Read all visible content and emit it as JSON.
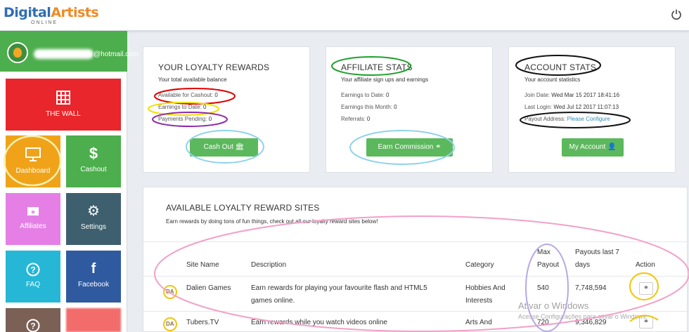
{
  "brand": {
    "logo_main": "Digital",
    "logo_accent": "Artists",
    "logo_sub": "ONLINE"
  },
  "user": {
    "email_suffix": "@hotmail.com"
  },
  "sidebar": {
    "items": [
      {
        "label": "THE WALL",
        "icon": "grid-icon",
        "color": "#e8262b"
      },
      {
        "label": "Dashboard",
        "icon": "monitor-icon",
        "color": "#f0a319"
      },
      {
        "label": "Cashout",
        "icon": "dollar-icon",
        "color": "#4cae4c"
      },
      {
        "label": "Affiliates",
        "icon": "ticket-icon",
        "color": "#e57fe6"
      },
      {
        "label": "Settings",
        "icon": "gear-icon",
        "color": "#3e5f6e"
      },
      {
        "label": "FAQ",
        "icon": "question-icon",
        "color": "#27b7d6"
      },
      {
        "label": "Facebook",
        "icon": "facebook-icon",
        "color": "#2f5aa0"
      }
    ],
    "partial": {
      "icon": "question-icon",
      "colors": [
        "#7b6056",
        "#f26c6c"
      ]
    }
  },
  "loyalty": {
    "title": "YOUR LOYALTY REWARDS",
    "subtitle": "Your total available balance",
    "available_label": "Available for Cashout:",
    "available_value": "0",
    "earnings_label": "Earnings to Date:",
    "earnings_value": "0",
    "pending_label": "Payments Pending:",
    "pending_value": "0",
    "button": "Cash Out"
  },
  "affiliate": {
    "title": "AFFILIATE STATS",
    "subtitle": "Your affiliate sign ups and earnings",
    "earnings_label": "Earnings to Date:",
    "earnings_value": "0",
    "month_label": "Earnings this Month:",
    "month_value": "0",
    "referrals_label": "Referrals:",
    "referrals_value": "0",
    "button": "Earn Commission"
  },
  "account": {
    "title": "ACCOUNT STATS",
    "subtitle": "Your account statistics",
    "join_label": "Join Date:",
    "join_value": "Wed Mar 15 2017 18:41:16",
    "login_label": "Last Login:",
    "login_value": "Wed Jul 12 2017 11:07:13",
    "payout_label": "Payout Address:",
    "payout_value": "Please Configure",
    "button": "My Account"
  },
  "sites": {
    "title": "AVAILABLE LOYALTY REWARD SITES",
    "subtitle": "Earn rewards by doing tons of fun things, check out all our loyalty reward sites below!",
    "columns": {
      "name": "Site Name",
      "description": "Description",
      "category": "Category",
      "max_payout_1": "Max",
      "max_payout_2": "Payout",
      "payouts_1": "Payouts last 7",
      "payouts_2": "days",
      "action": "Action"
    },
    "rows": [
      {
        "icon": "DA",
        "name": "Dalien Games",
        "desc_1": "Earn rewards for playing your favourite flash and HTML5",
        "desc_2": "games online.",
        "cat_1": "Hobbies And",
        "cat_2": "Interests",
        "max": "540",
        "payouts": "7,748,594"
      },
      {
        "icon": "DA",
        "name": "Tubers.TV",
        "desc_1": "Earn rewards while you watch videos online",
        "desc_2": "",
        "cat_1": "Arts And",
        "cat_2": "",
        "max": "720",
        "payouts": "9,346,829"
      }
    ]
  },
  "watermark": {
    "line1": "Ativar o Windows",
    "line2": "Acesse Configurações para ativar o Windows."
  }
}
